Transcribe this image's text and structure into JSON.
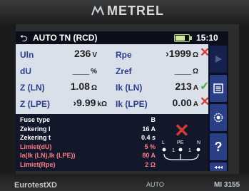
{
  "brand": "METREL",
  "screen": {
    "title": "AUTO TN (RCD)",
    "time": "15:10",
    "battery_level": 0.7
  },
  "results": {
    "uln": {
      "label": "Uln",
      "value": "236",
      "unit": "V"
    },
    "du": {
      "label": "dU",
      "value": "___",
      "unit": "%"
    },
    "zln": {
      "label": "Z (LN)",
      "value": "1.08",
      "unit": "Ω"
    },
    "zlpe": {
      "label": "Z (LPE)",
      "value": "›9.99",
      "unit": "kΩ"
    },
    "rpe": {
      "label": "Rpe",
      "value": "›1999",
      "unit": "Ω",
      "status": "fail"
    },
    "zref": {
      "label": "Zref",
      "value": "___",
      "unit": "Ω"
    },
    "ikln": {
      "label": "Ik (LN)",
      "value": "213",
      "unit": "A",
      "status": "pass"
    },
    "iklpe": {
      "label": "Ik (LPE)",
      "value": "0.00",
      "unit": "A",
      "status": "fail"
    }
  },
  "params": [
    {
      "label": "Fuse type",
      "value": "B",
      "color": "#ffffff"
    },
    {
      "label": "Zekering I",
      "value": "16 A",
      "color": "#ffffff"
    },
    {
      "label": "Zekering t",
      "value": "0.4 s",
      "color": "#ffffff"
    },
    {
      "label": "Limiet(dU)",
      "value": "5 %",
      "color": "#ff7a86"
    },
    {
      "label": "Ia(Ik (LN),Ik (LPE))",
      "value": "80 A",
      "color": "#ff7a86"
    },
    {
      "label": "Limiet(Rpe)",
      "value": "2 Ω",
      "color": "#ff7a86"
    }
  ],
  "diagram": {
    "l": "L",
    "pe": "PE",
    "n": "N",
    "one_a": "1",
    "one_b": "1"
  },
  "side_buttons": [
    "play-icon",
    "list-icon",
    "settings-icon",
    "help-icon",
    "more-icon"
  ],
  "bottom": {
    "left": "EurotestXD",
    "mid": "AUTO",
    "right": "MI 3155"
  },
  "colors": {
    "fail": "#d23a35",
    "pass": "#4aa84a",
    "label": "#2d3d8a",
    "limit": "#ff7a86"
  }
}
